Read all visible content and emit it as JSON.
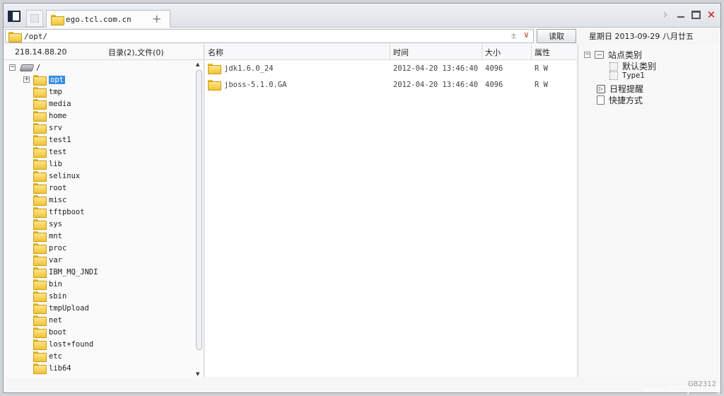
{
  "tabs": {
    "active_label": "ego.tcl.com.cn",
    "new_tab_symbol": "+"
  },
  "address": {
    "path": "/opt/",
    "plusminus": "±",
    "read_label": "读取"
  },
  "date_strip": "星期日 2013-09-29 八月廿五",
  "left": {
    "ip": "218.14.88.20",
    "summary": "目录(2),文件(0)",
    "root_label": "/",
    "folders": [
      "opt",
      "tmp",
      "media",
      "home",
      "srv",
      "test1",
      "test",
      "lib",
      "selinux",
      "root",
      "misc",
      "tftpboot",
      "sys",
      "mnt",
      "proc",
      "var",
      "IBM_MQ_JNDI",
      "bin",
      "sbin",
      "tmpUpload",
      "net",
      "boot",
      "lost+found",
      "etc",
      "lib64"
    ],
    "selected": "opt"
  },
  "list": {
    "headers": {
      "name": "名称",
      "time": "时间",
      "size": "大小",
      "attr": "属性"
    },
    "rows": [
      {
        "name": "jdk1.6.0_24",
        "time": "2012-04-20 13:46:40",
        "size": "4096",
        "attr": "R W"
      },
      {
        "name": "jboss-5.1.0.GA",
        "time": "2012-04-20 13:46:40",
        "size": "4096",
        "attr": "R W"
      }
    ]
  },
  "right": {
    "site_category": "站点类别",
    "default_category": "默认类别",
    "type1": "Type1",
    "schedule": "日程提醒",
    "shortcut": "快捷方式"
  },
  "footer": {
    "encoding": "GB2312",
    "watermark": "www.wooyun.org"
  },
  "colors": {
    "selection": "#3a8ee6",
    "close": "#d21c1c",
    "folder": "#f2c338"
  },
  "icons": [
    "panel-toggle-icon",
    "folder-icon",
    "drive-icon",
    "close-icon",
    "minimize-icon",
    "maximize-icon",
    "chevron-right-icon",
    "dropdown-arrow-icon"
  ]
}
